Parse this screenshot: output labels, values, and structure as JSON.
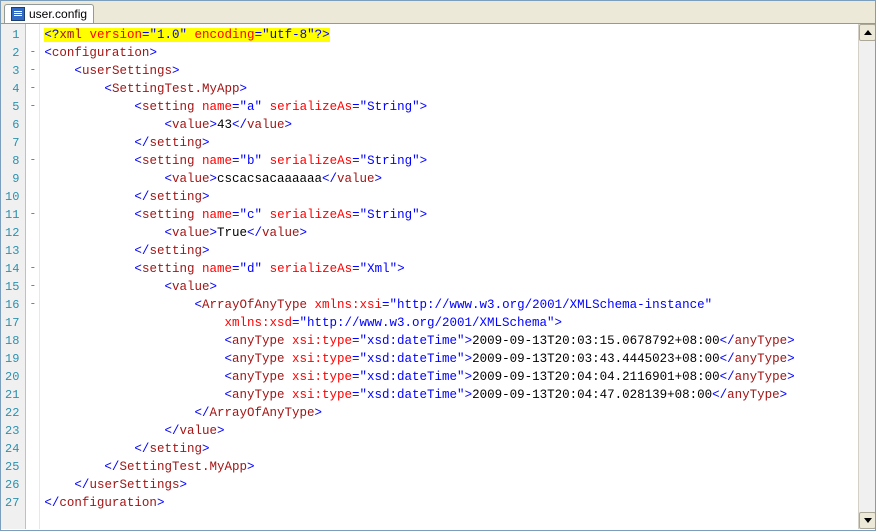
{
  "tab": {
    "label": "user.config"
  },
  "lines": [
    {
      "n": 1,
      "fold": "",
      "html": "<span class='hl'><span class='tag'>&lt;?</span><span class='elem'>xml</span> <span class='attr'>version</span><span class='tag'>=</span><span class='tag'>\"</span><span class='str'>1.0</span><span class='tag'>\"</span> <span class='attr'>encoding</span><span class='tag'>=</span><span class='tag'>\"</span><span class='str'>utf-8</span><span class='tag'>\"</span><span class='tag'>?&gt;</span></span>"
    },
    {
      "n": 2,
      "fold": "-",
      "html": "<span class='tag'>&lt;</span><span class='elem'>configuration</span><span class='tag'>&gt;</span>"
    },
    {
      "n": 3,
      "fold": "-",
      "html": "    <span class='tag'>&lt;</span><span class='elem'>userSettings</span><span class='tag'>&gt;</span>"
    },
    {
      "n": 4,
      "fold": "-",
      "html": "        <span class='tag'>&lt;</span><span class='elem'>SettingTest.MyApp</span><span class='tag'>&gt;</span>"
    },
    {
      "n": 5,
      "fold": "-",
      "html": "            <span class='tag'>&lt;</span><span class='elem'>setting</span> <span class='attr'>name</span><span class='tag'>=</span><span class='tag'>\"</span><span class='str'>a</span><span class='tag'>\"</span> <span class='attr'>serializeAs</span><span class='tag'>=</span><span class='tag'>\"</span><span class='str'>String</span><span class='tag'>\"</span><span class='tag'>&gt;</span>"
    },
    {
      "n": 6,
      "fold": "",
      "html": "                <span class='tag'>&lt;</span><span class='elem'>value</span><span class='tag'>&gt;</span><span class='txt'>43</span><span class='tag'>&lt;/</span><span class='elem'>value</span><span class='tag'>&gt;</span>"
    },
    {
      "n": 7,
      "fold": "",
      "html": "            <span class='tag'>&lt;/</span><span class='elem'>setting</span><span class='tag'>&gt;</span>"
    },
    {
      "n": 8,
      "fold": "-",
      "html": "            <span class='tag'>&lt;</span><span class='elem'>setting</span> <span class='attr'>name</span><span class='tag'>=</span><span class='tag'>\"</span><span class='str'>b</span><span class='tag'>\"</span> <span class='attr'>serializeAs</span><span class='tag'>=</span><span class='tag'>\"</span><span class='str'>String</span><span class='tag'>\"</span><span class='tag'>&gt;</span>"
    },
    {
      "n": 9,
      "fold": "",
      "html": "                <span class='tag'>&lt;</span><span class='elem'>value</span><span class='tag'>&gt;</span><span class='txt'>cscacsacaaaaaa</span><span class='tag'>&lt;/</span><span class='elem'>value</span><span class='tag'>&gt;</span>"
    },
    {
      "n": 10,
      "fold": "",
      "html": "            <span class='tag'>&lt;/</span><span class='elem'>setting</span><span class='tag'>&gt;</span>"
    },
    {
      "n": 11,
      "fold": "-",
      "html": "            <span class='tag'>&lt;</span><span class='elem'>setting</span> <span class='attr'>name</span><span class='tag'>=</span><span class='tag'>\"</span><span class='str'>c</span><span class='tag'>\"</span> <span class='attr'>serializeAs</span><span class='tag'>=</span><span class='tag'>\"</span><span class='str'>String</span><span class='tag'>\"</span><span class='tag'>&gt;</span>"
    },
    {
      "n": 12,
      "fold": "",
      "html": "                <span class='tag'>&lt;</span><span class='elem'>value</span><span class='tag'>&gt;</span><span class='txt'>True</span><span class='tag'>&lt;/</span><span class='elem'>value</span><span class='tag'>&gt;</span>"
    },
    {
      "n": 13,
      "fold": "",
      "html": "            <span class='tag'>&lt;/</span><span class='elem'>setting</span><span class='tag'>&gt;</span>"
    },
    {
      "n": 14,
      "fold": "-",
      "html": "            <span class='tag'>&lt;</span><span class='elem'>setting</span> <span class='attr'>name</span><span class='tag'>=</span><span class='tag'>\"</span><span class='str'>d</span><span class='tag'>\"</span> <span class='attr'>serializeAs</span><span class='tag'>=</span><span class='tag'>\"</span><span class='str'>Xml</span><span class='tag'>\"</span><span class='tag'>&gt;</span>"
    },
    {
      "n": 15,
      "fold": "-",
      "html": "                <span class='tag'>&lt;</span><span class='elem'>value</span><span class='tag'>&gt;</span>"
    },
    {
      "n": 16,
      "fold": "-",
      "html": "                    <span class='tag'>&lt;</span><span class='elem'>ArrayOfAnyType</span> <span class='attr'>xmlns:xsi</span><span class='tag'>=</span><span class='tag'>\"</span><span class='str'>http://www.w3.org/2001/XMLSchema-instance</span><span class='tag'>\"</span>"
    },
    {
      "n": 17,
      "fold": "",
      "html": "                        <span class='attr'>xmlns:xsd</span><span class='tag'>=</span><span class='tag'>\"</span><span class='str'>http://www.w3.org/2001/XMLSchema</span><span class='tag'>\"</span><span class='tag'>&gt;</span>"
    },
    {
      "n": 18,
      "fold": "",
      "html": "                        <span class='tag'>&lt;</span><span class='elem'>anyType</span> <span class='attr'>xsi:type</span><span class='tag'>=</span><span class='tag'>\"</span><span class='str'>xsd:dateTime</span><span class='tag'>\"</span><span class='tag'>&gt;</span><span class='txt'>2009-09-13T20:03:15.0678792+08:00</span><span class='tag'>&lt;/</span><span class='elem'>anyType</span><span class='tag'>&gt;</span>"
    },
    {
      "n": 19,
      "fold": "",
      "html": "                        <span class='tag'>&lt;</span><span class='elem'>anyType</span> <span class='attr'>xsi:type</span><span class='tag'>=</span><span class='tag'>\"</span><span class='str'>xsd:dateTime</span><span class='tag'>\"</span><span class='tag'>&gt;</span><span class='txt'>2009-09-13T20:03:43.4445023+08:00</span><span class='tag'>&lt;/</span><span class='elem'>anyType</span><span class='tag'>&gt;</span>"
    },
    {
      "n": 20,
      "fold": "",
      "html": "                        <span class='tag'>&lt;</span><span class='elem'>anyType</span> <span class='attr'>xsi:type</span><span class='tag'>=</span><span class='tag'>\"</span><span class='str'>xsd:dateTime</span><span class='tag'>\"</span><span class='tag'>&gt;</span><span class='txt'>2009-09-13T20:04:04.2116901+08:00</span><span class='tag'>&lt;/</span><span class='elem'>anyType</span><span class='tag'>&gt;</span>"
    },
    {
      "n": 21,
      "fold": "",
      "html": "                        <span class='tag'>&lt;</span><span class='elem'>anyType</span> <span class='attr'>xsi:type</span><span class='tag'>=</span><span class='tag'>\"</span><span class='str'>xsd:dateTime</span><span class='tag'>\"</span><span class='tag'>&gt;</span><span class='txt'>2009-09-13T20:04:47.028139+08:00</span><span class='tag'>&lt;/</span><span class='elem'>anyType</span><span class='tag'>&gt;</span>"
    },
    {
      "n": 22,
      "fold": "",
      "html": "                    <span class='tag'>&lt;/</span><span class='elem'>ArrayOfAnyType</span><span class='tag'>&gt;</span>"
    },
    {
      "n": 23,
      "fold": "",
      "html": "                <span class='tag'>&lt;/</span><span class='elem'>value</span><span class='tag'>&gt;</span>"
    },
    {
      "n": 24,
      "fold": "",
      "html": "            <span class='tag'>&lt;/</span><span class='elem'>setting</span><span class='tag'>&gt;</span>"
    },
    {
      "n": 25,
      "fold": "",
      "html": "        <span class='tag'>&lt;/</span><span class='elem'>SettingTest.MyApp</span><span class='tag'>&gt;</span>"
    },
    {
      "n": 26,
      "fold": "",
      "html": "    <span class='tag'>&lt;/</span><span class='elem'>userSettings</span><span class='tag'>&gt;</span>"
    },
    {
      "n": 27,
      "fold": "",
      "html": "<span class='tag'>&lt;/</span><span class='elem'>configuration</span><span class='tag'>&gt;</span>"
    }
  ]
}
